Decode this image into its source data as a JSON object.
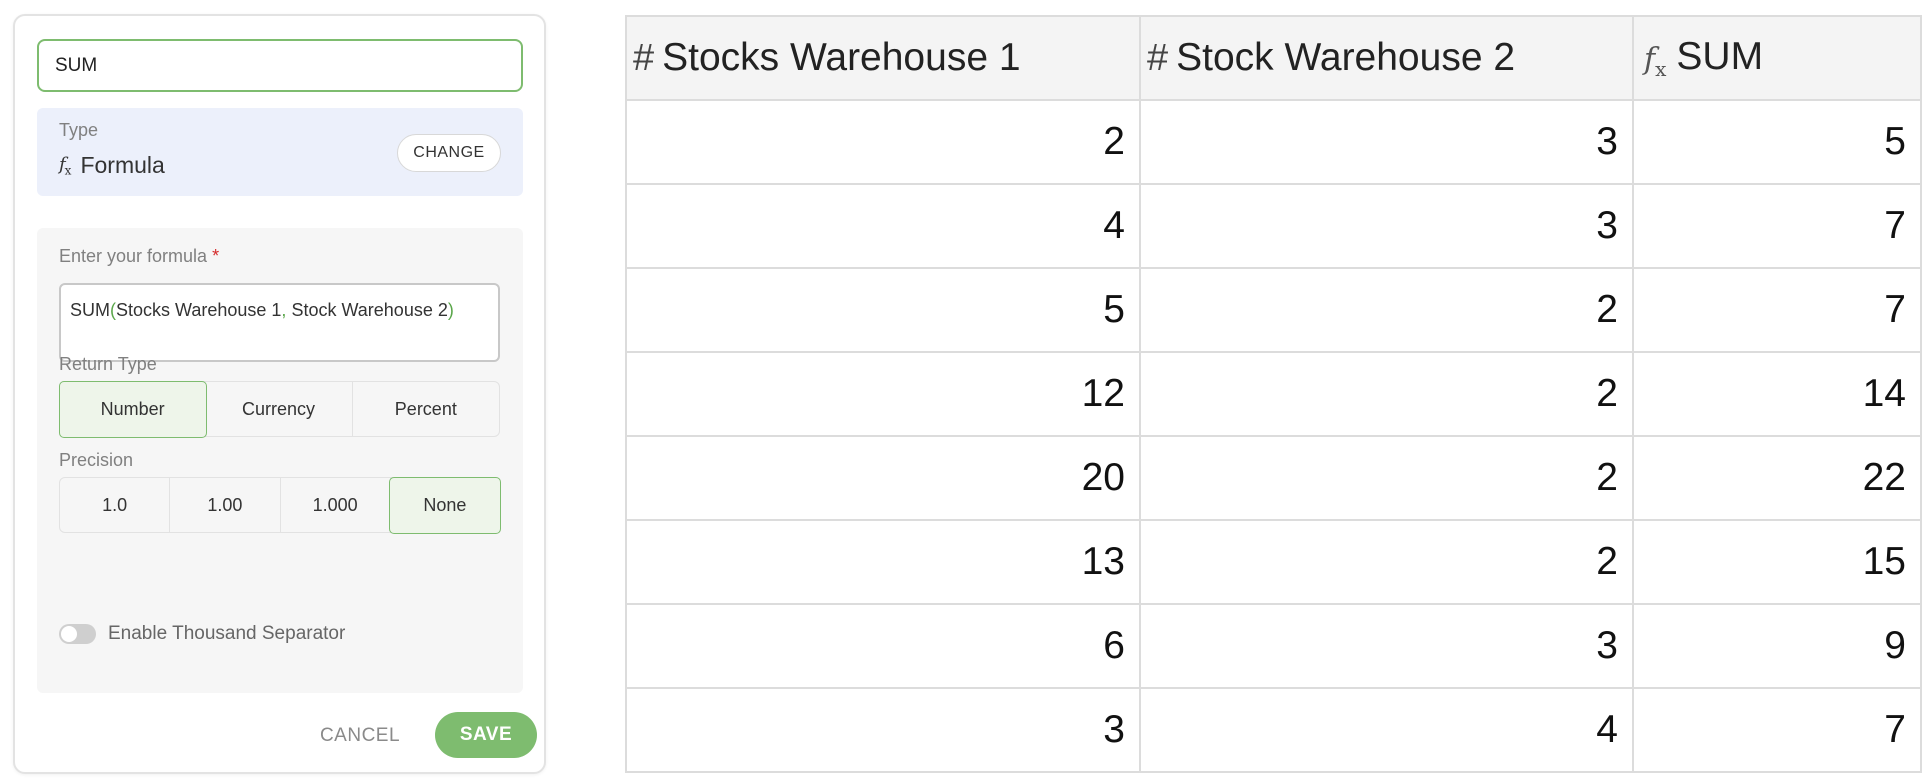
{
  "panel": {
    "field_name": "SUM",
    "type_label": "Type",
    "type_icon": "fx-icon",
    "type_value": "Formula",
    "change_label": "CHANGE",
    "formula_label": "Enter your formula",
    "required_mark": "*",
    "formula": {
      "fn": "SUM",
      "open_paren": "(",
      "arg1": "Stocks Warehouse 1",
      "comma": ",",
      "arg2": " Stock Warehouse 2",
      "close_paren": ")"
    },
    "return_type_label": "Return Type",
    "return_types": [
      "Number",
      "Currency",
      "Percent"
    ],
    "return_type_selected": "Number",
    "precision_label": "Precision",
    "precisions": [
      "1.0",
      "1.00",
      "1.000",
      "None"
    ],
    "precision_selected": "None",
    "thousand_separator_label": "Enable Thousand Separator",
    "thousand_separator_enabled": false,
    "cancel_label": "CANCEL",
    "save_label": "SAVE",
    "accent_color": "#7ebc6f"
  },
  "table": {
    "columns": [
      {
        "icon": "hash-icon",
        "label": "Stocks Warehouse 1"
      },
      {
        "icon": "hash-icon",
        "label": "Stock Warehouse 2"
      },
      {
        "icon": "fx-icon",
        "label": "SUM"
      }
    ],
    "rows": [
      [
        "2",
        "3",
        "5"
      ],
      [
        "4",
        "3",
        "7"
      ],
      [
        "5",
        "2",
        "7"
      ],
      [
        "12",
        "2",
        "14"
      ],
      [
        "20",
        "2",
        "22"
      ],
      [
        "13",
        "2",
        "15"
      ],
      [
        "6",
        "3",
        "9"
      ],
      [
        "3",
        "4",
        "7"
      ]
    ]
  }
}
